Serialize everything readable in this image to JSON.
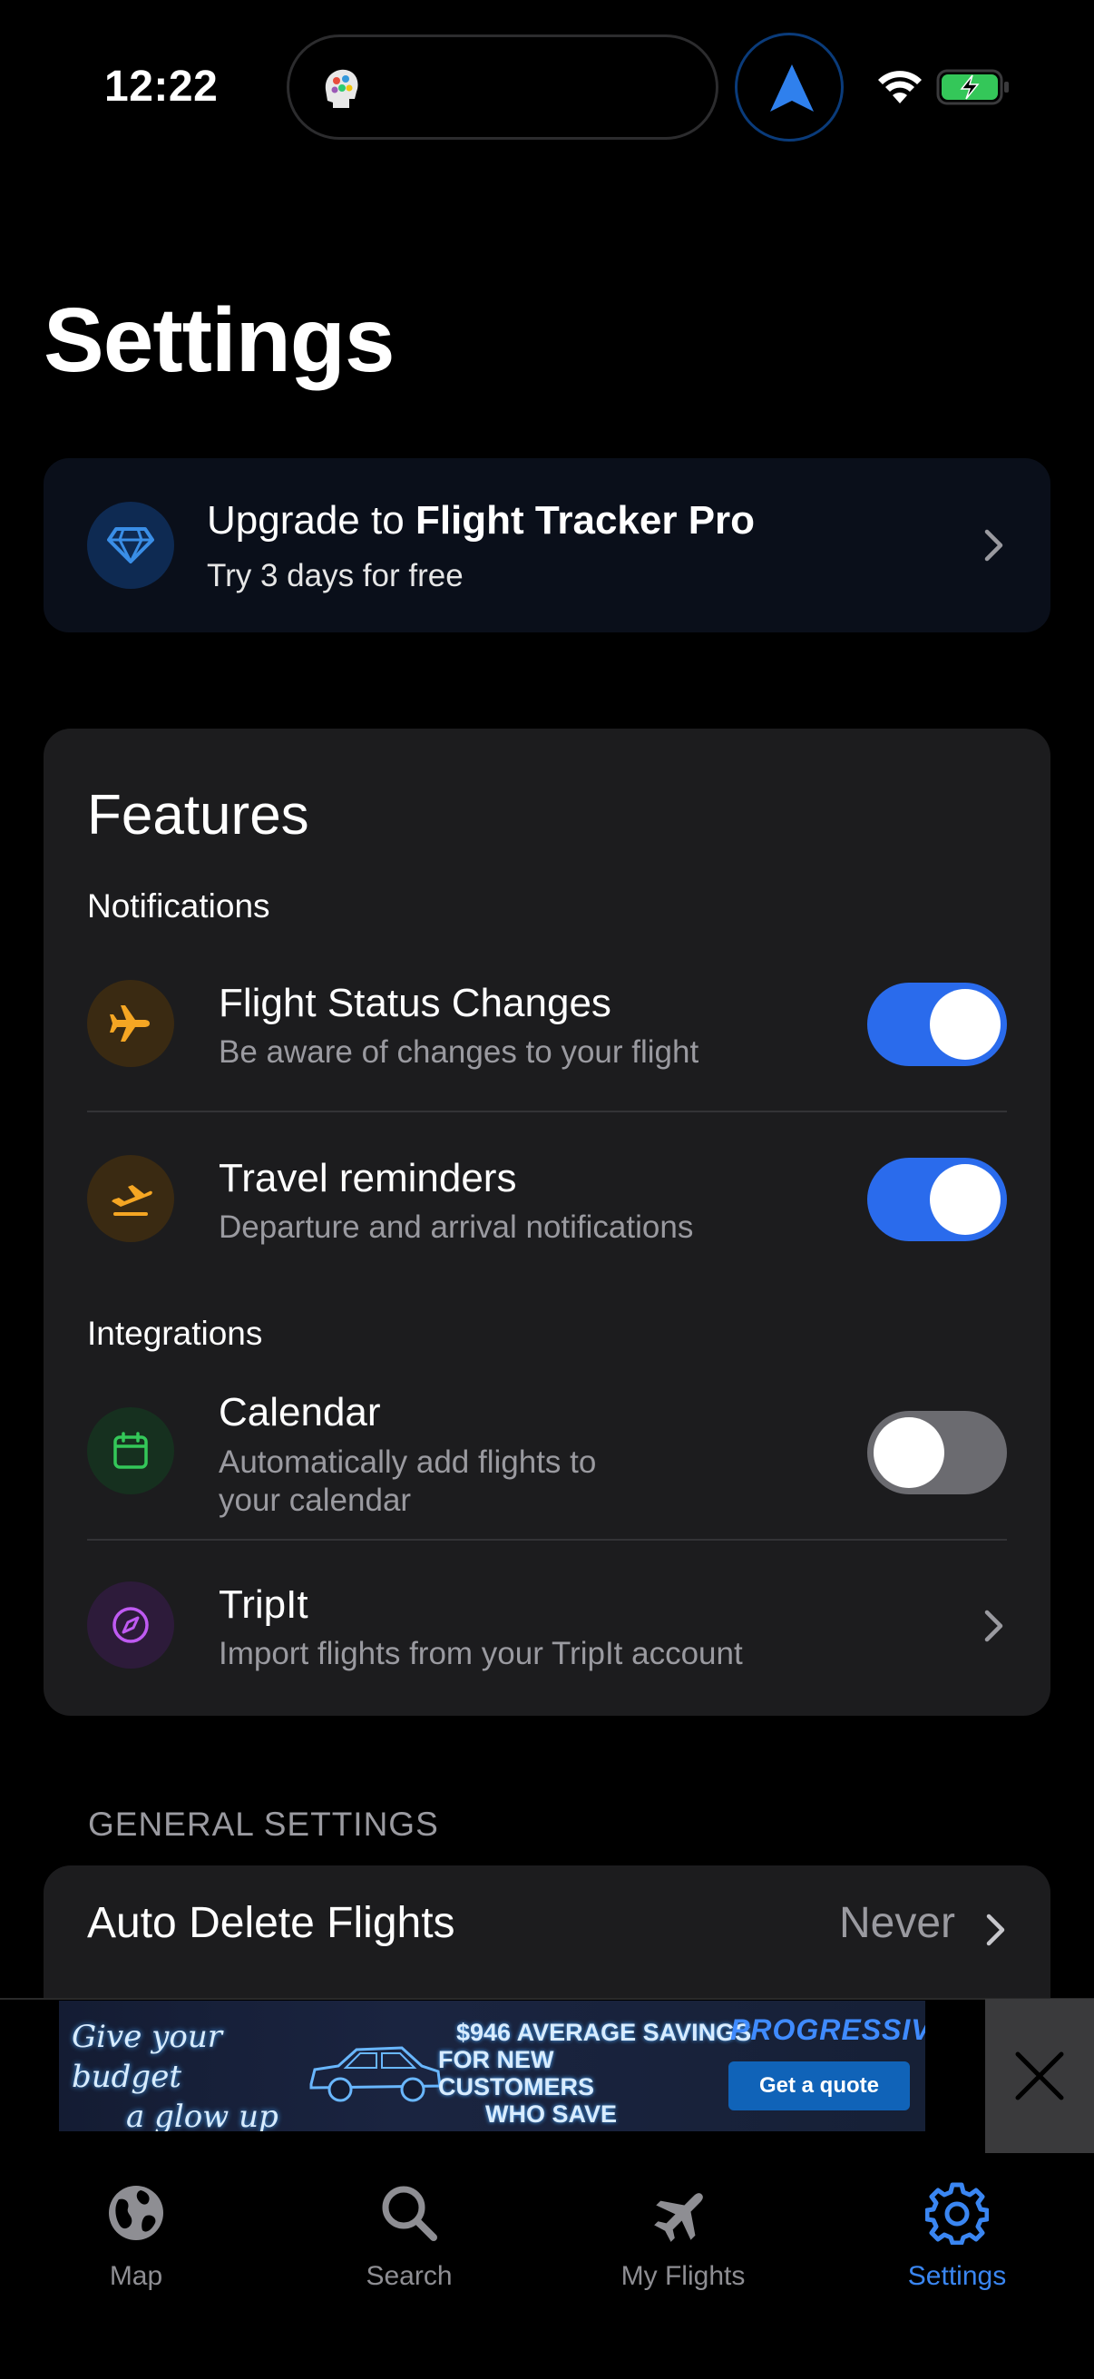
{
  "status_bar": {
    "time": "12:22"
  },
  "page": {
    "title": "Settings"
  },
  "upgrade": {
    "prefix": "Upgrade to ",
    "product": "Flight Tracker Pro",
    "subtitle": "Try 3 days for free"
  },
  "features": {
    "title": "Features",
    "notifications_header": "Notifications",
    "integrations_header": "Integrations",
    "items": [
      {
        "title": "Flight Status Changes",
        "subtitle": "Be aware of changes to your flight",
        "icon": "airplane-icon",
        "toggle": "on"
      },
      {
        "title": "Travel reminders",
        "subtitle": "Departure and arrival notifications",
        "icon": "departure-icon",
        "toggle": "on"
      },
      {
        "title": "Calendar",
        "subtitle": "Automatically add flights to your calendar",
        "subtitle_line1": "Automatically add flights to",
        "subtitle_line2": "your calendar",
        "icon": "calendar-icon",
        "toggle": "off"
      },
      {
        "title": "TripIt",
        "subtitle": "Import flights from your TripIt account",
        "icon": "compass-icon"
      }
    ]
  },
  "general": {
    "header": "GENERAL SETTINGS",
    "auto_delete_label": "Auto Delete Flights",
    "auto_delete_value": "Never"
  },
  "ad": {
    "headline_line1": "Give your budget",
    "headline_line2": "a glow up",
    "savings_line1": "$946 AVERAGE SAVINGS",
    "savings_line2": "FOR NEW CUSTOMERS",
    "savings_line3": "WHO SAVE",
    "brand": "PROGRESSIVE",
    "cta": "Get a quote"
  },
  "tabbar": {
    "tabs": [
      {
        "label": "Map",
        "icon": "globe-icon",
        "active": false
      },
      {
        "label": "Search",
        "icon": "search-icon",
        "active": false
      },
      {
        "label": "My Flights",
        "icon": "airplane-icon",
        "active": false
      },
      {
        "label": "Settings",
        "icon": "gear-icon",
        "active": true
      }
    ]
  },
  "colors": {
    "accent": "#2a6bec",
    "active_tab": "#3a86f2",
    "card_bg": "#1c1c1e",
    "orange_icon": "#f5a623",
    "green_icon": "#34c759",
    "purple_icon": "#bf5af2"
  }
}
